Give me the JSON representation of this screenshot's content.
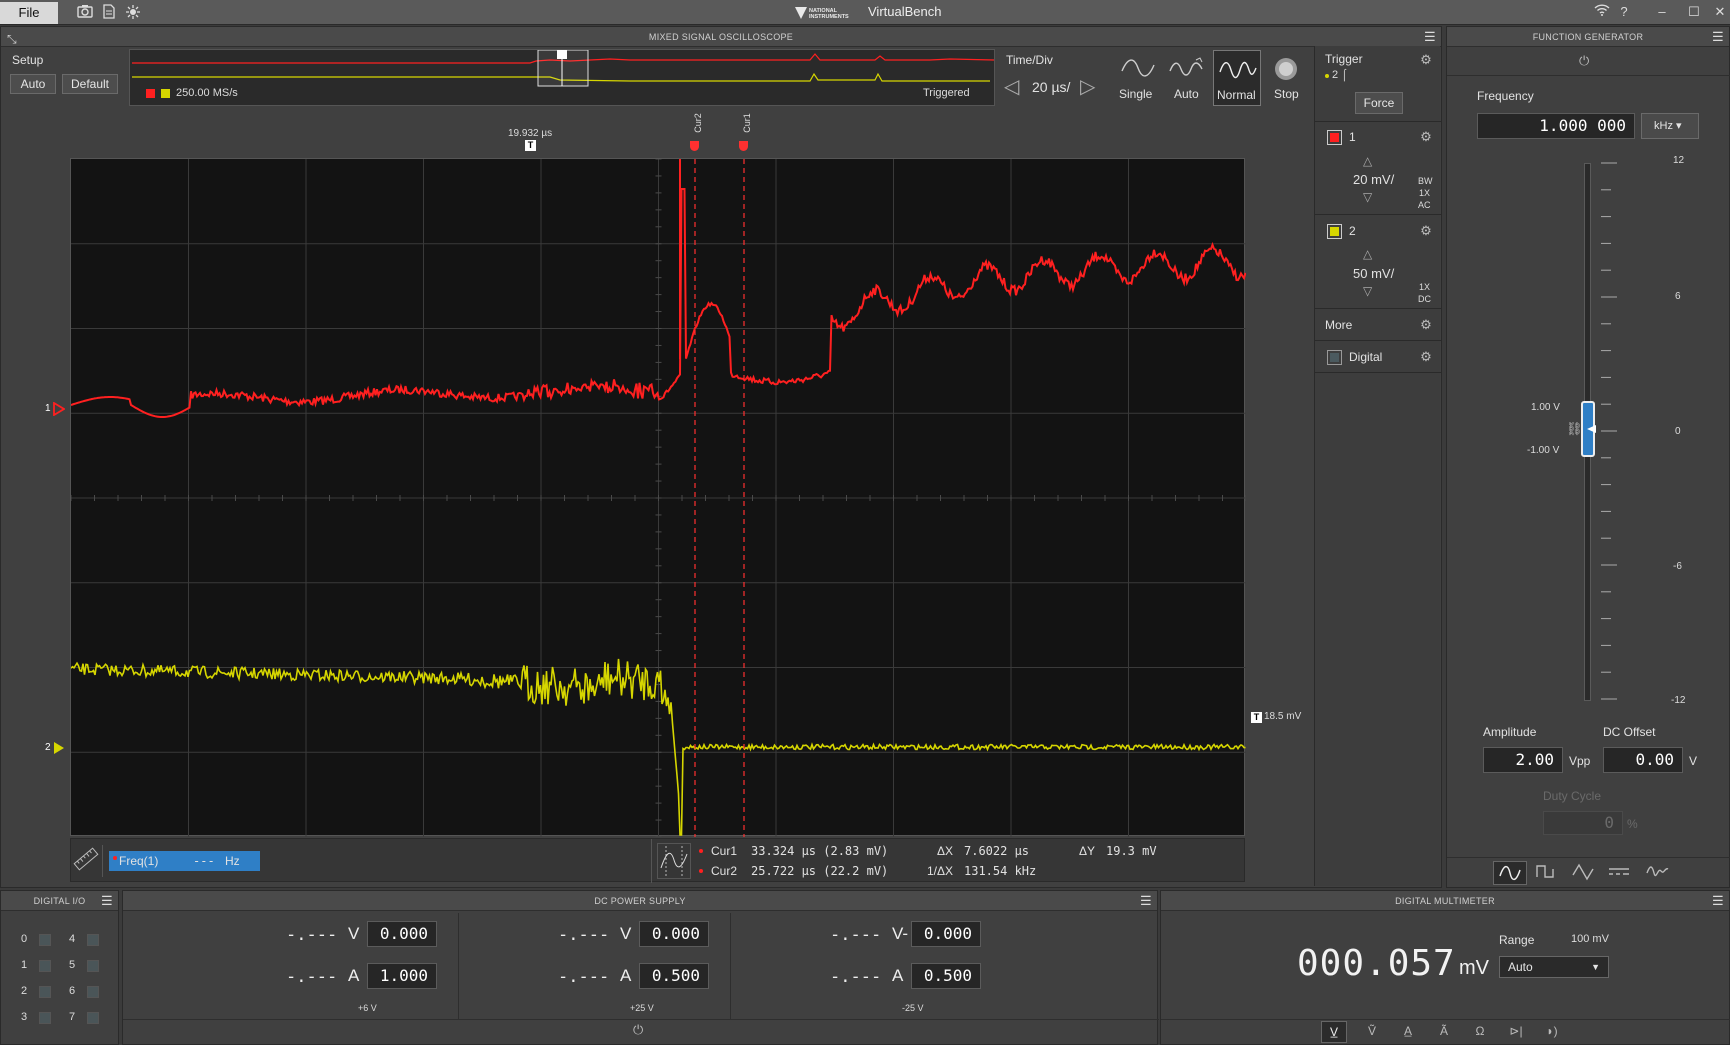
{
  "titlebar": {
    "file": "File",
    "app_title": "VirtualBench",
    "logo_text": "NATIONAL INSTRUMENTS",
    "help": "?"
  },
  "scope": {
    "header": "MIXED SIGNAL OSCILLOSCOPE",
    "setup_label": "Setup",
    "auto_btn": "Auto",
    "default_btn": "Default",
    "sample_rate": "250.00 MS/s",
    "trigger_state": "Triggered",
    "timediv_label": "Time/Div",
    "timediv_value": "20 µs/",
    "modes": [
      "Single",
      "Auto",
      "Normal",
      "Stop"
    ],
    "active_mode": "Normal",
    "trigger_position": "19.932 µs",
    "trigger_level": "18.5 mV",
    "cursor_labels": [
      "Cur2",
      "Cur1"
    ],
    "freq_label": "Freq(1)",
    "freq_value": "---",
    "freq_unit": "Hz",
    "cur1_label": "Cur1",
    "cur1_value": "33.324 µs (2.83 mV)",
    "cur2_label": "Cur2",
    "cur2_value": "25.722 µs (22.2 mV)",
    "dx_label": "ΔX",
    "dx_value": "7.6022 µs",
    "inv_dx_label": "1/ΔX",
    "inv_dx_value": "131.54 kHz",
    "dy_label": "ΔY",
    "dy_value": "19.3 mV",
    "ch1_marker": "1",
    "ch2_marker": "2",
    "colors": {
      "ch1": "#ff2020",
      "ch2": "#d6d600",
      "bg": "#131313",
      "cursor": "#ff3030"
    }
  },
  "side": {
    "trigger_label": "Trigger",
    "trigger_source": "2",
    "force_btn": "Force",
    "ch1": {
      "num": "1",
      "scale": "20 mV/",
      "flags": [
        "BW",
        "1X",
        "AC"
      ]
    },
    "ch2": {
      "num": "2",
      "scale": "50 mV/",
      "flags": [
        "1X",
        "DC"
      ]
    },
    "more_label": "More",
    "digital_label": "Digital"
  },
  "fgen": {
    "header": "FUNCTION GENERATOR",
    "freq_label": "Frequency",
    "freq_value": "1.000 000",
    "freq_unit": "kHz",
    "scale_labels": [
      "12",
      "6",
      "0",
      "-6",
      "-12"
    ],
    "high_level": "1.00 V",
    "low_level": "-1.00 V",
    "amp_label": "Amplitude",
    "amp_value": "2.00",
    "amp_unit": "Vpp",
    "offset_label": "DC Offset",
    "offset_value": "0.00",
    "offset_unit": "V",
    "duty_label": "Duty Cycle",
    "duty_value": "0",
    "duty_unit": "%"
  },
  "dio": {
    "header": "DIGITAL I/O",
    "lines": [
      "0",
      "4",
      "1",
      "5",
      "2",
      "6",
      "3",
      "7"
    ]
  },
  "dcps": {
    "header": "DC POWER SUPPLY",
    "channels": [
      {
        "v_read": "-.---",
        "v_unit": "V",
        "v_set": "0.000",
        "a_read": "-.---",
        "a_unit": "A",
        "a_set": "1.000",
        "name": "+6 V"
      },
      {
        "v_read": "-.---",
        "v_unit": "V",
        "v_set": "0.000",
        "a_read": "-.---",
        "a_unit": "A",
        "a_set": "0.500",
        "name": "+25 V"
      },
      {
        "v_read": "-.---",
        "v_unit": "V-",
        "v_set": "0.000",
        "a_read": "-.---",
        "a_unit": "A",
        "a_set": "0.500",
        "name": "-25 V"
      }
    ]
  },
  "dmm": {
    "header": "DIGITAL MULTIMETER",
    "reading": "000.057",
    "unit": "mV",
    "range_label": "Range",
    "range_value": "100 mV",
    "range_select": "Auto"
  }
}
